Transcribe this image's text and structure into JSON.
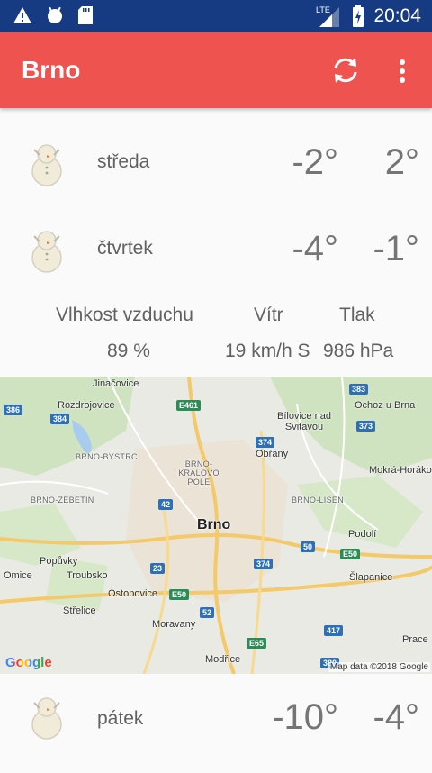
{
  "status_bar": {
    "time": "20:04",
    "network": "LTE",
    "left_icons": [
      "warning-icon",
      "android-icon",
      "sd-card-icon"
    ],
    "right_icons": [
      "signal-icon",
      "battery-charging-icon"
    ]
  },
  "app_bar": {
    "title": "Brno",
    "actions": [
      "refresh-icon",
      "overflow-menu-icon"
    ],
    "color": "#ef5350"
  },
  "forecast": [
    {
      "icon": "snowman-icon",
      "day": "středa",
      "low": "-2°",
      "high": "2°"
    },
    {
      "icon": "snowman-icon",
      "day": "čtvrtek",
      "low": "-4°",
      "high": "-1°"
    },
    {
      "icon": "snowman-icon",
      "day": "pátek",
      "low": "-10°",
      "high": "-4°"
    }
  ],
  "details": {
    "humidity_label": "Vlhkost vzduchu",
    "humidity_value": "89 %",
    "wind_label": "Vítr",
    "wind_value": "19 km/h S",
    "pressure_label": "Tlak",
    "pressure_value": "986 hPa"
  },
  "map": {
    "center_city": "Brno",
    "places": [
      "Jinačovice",
      "Rozdrojovice",
      "Bílovice nad Svitavou",
      "Ochoz u Brna",
      "BRNO-BYSTRC",
      "BRNO-KRÁLOVO POLE",
      "Obřany",
      "Mokrá-Horákov",
      "BRNO-ŽEBĚTÍN",
      "BRNO-LÍŠEŇ",
      "Podolí",
      "Popůvky",
      "Troubsko",
      "Omice",
      "Ostopovice",
      "Šlapanice",
      "Střelice",
      "Moravany",
      "Modřice",
      "Prace"
    ],
    "roads": [
      "386",
      "384",
      "E461",
      "383",
      "373",
      "374",
      "42",
      "50",
      "E50",
      "23",
      "52",
      "E65",
      "417",
      "374",
      "E50",
      "380"
    ],
    "google_logo": "Google",
    "copyright": "Map data ©2018 Google"
  }
}
